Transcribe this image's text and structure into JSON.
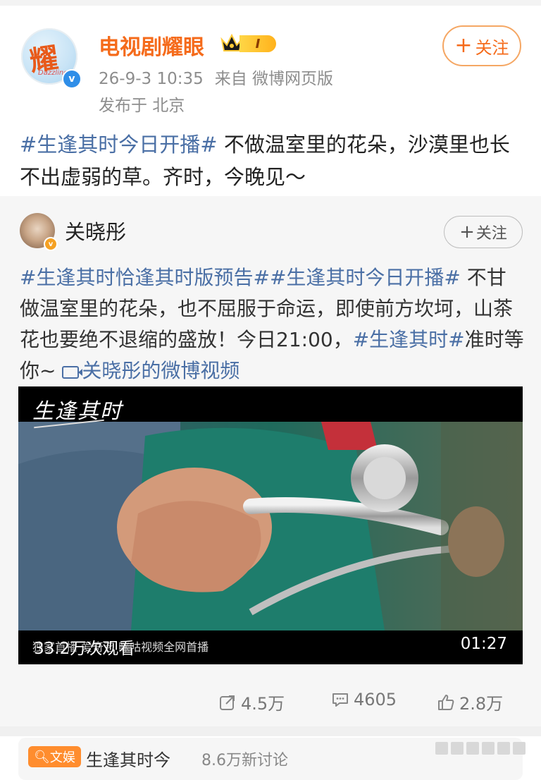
{
  "post": {
    "author": "电视剧耀眼",
    "vip_level": "I",
    "time": "26-9-3 10:35",
    "source": "来自 微博网页版",
    "location": "发布于 北京",
    "follow_label": "关注",
    "follow_plus": "+",
    "hashtag": "#生逢其时今日开播#",
    "text": " 不做温室里的花朵，沙漠里也长不出虚弱的草。齐时，今晚见～"
  },
  "repost": {
    "author": "关晓彤",
    "follow_label": "关注",
    "follow_plus": "+",
    "hashtag1": "#生逢其时恰逢其时版预告#",
    "hashtag2": "#生逢其时今日开播#",
    "text1": " 不甘做温室里的花朵，也不屈服于命运，即使前方坎坷，山茶花也要绝不退缩的盛放！今日21:00，",
    "hashtag3": "#生逢其时#",
    "text2": "准时等你~ ",
    "video_link": "关晓彤的微博视频",
    "video": {
      "brand": "生逢其时",
      "subtitle": "独家首播 爱奇艺 咪咕视频全网首播",
      "views": "33.2万次观看",
      "duration": "01:27"
    }
  },
  "actions": {
    "reposts": "4.5万",
    "comments": "4605",
    "likes": "2.8万"
  },
  "topic": {
    "tag": "文娱",
    "name": "生逢其时今",
    "count": "8.6万新讨论"
  },
  "colors": {
    "accent": "#f56b1b",
    "link": "#4a6fa5",
    "vip": "#ffc22e"
  }
}
